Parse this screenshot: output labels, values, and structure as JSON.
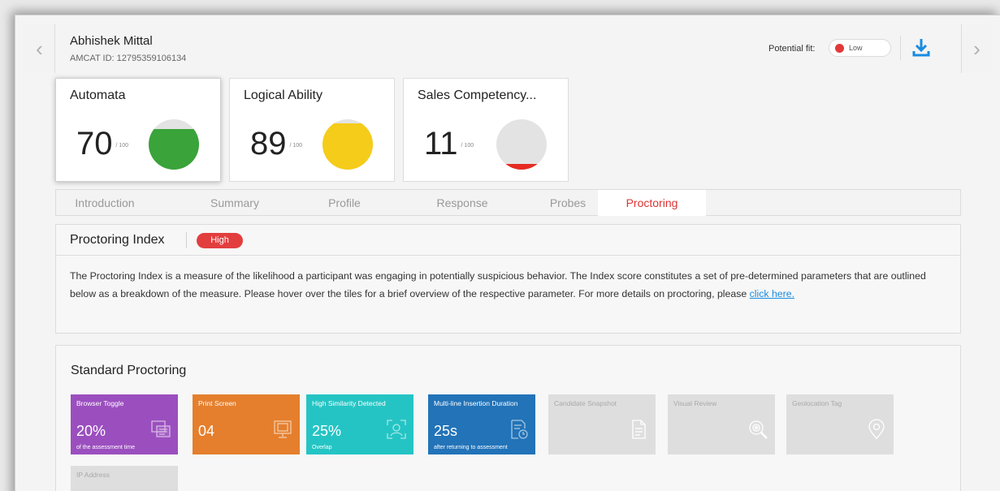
{
  "candidate": {
    "name": "Abhishek Mittal",
    "amcat_id": "AMCAT ID: 12795359106134"
  },
  "header": {
    "potential_fit_label": "Potential fit:",
    "potential_fit_value": "Low",
    "fit_color": "#e23a3a"
  },
  "scores": [
    {
      "title": "Automata",
      "value": "70",
      "max": "/ 100",
      "fill_level": 0.8,
      "color": "#3aa33a"
    },
    {
      "title": "Logical Ability",
      "value": "89",
      "max": "/ 100",
      "fill_level": 0.92,
      "color": "#f5cc1a"
    },
    {
      "title": "Sales Competency...",
      "value": "11",
      "max": "/ 100",
      "fill_level": 0.12,
      "color": "#e52b22"
    }
  ],
  "tabs": [
    {
      "label": "Introduction"
    },
    {
      "label": "Summary"
    },
    {
      "label": "Profile"
    },
    {
      "label": "Response"
    },
    {
      "label": "Probes"
    },
    {
      "label": "Proctoring"
    }
  ],
  "active_tab": "Proctoring",
  "proctoring_index": {
    "title": "Proctoring Index",
    "badge": "High",
    "description": "The Proctoring Index is a measure of the likelihood a participant was engaging in potentially suspicious behavior. The Index score constitutes a set of pre-determined parameters that are outlined below as a breakdown of the measure. Please hover over the tiles for a brief overview of the respective parameter. For more details on proctoring, please ",
    "link_text": "click here."
  },
  "standard_proctoring": {
    "title": "Standard Proctoring",
    "tiles": [
      {
        "name": "Browser Toggle",
        "value": "20%",
        "sub": "of the assessment time",
        "color": "#9b4fbf",
        "icon": "browser-windows-icon"
      },
      {
        "name": "Print Screen",
        "value": "04",
        "sub": "",
        "color": "#e57f2d",
        "icon": "monitor-icon"
      },
      {
        "name": "High Similarity Detected",
        "value": "25%",
        "sub": "Overlap",
        "color": "#25c4c4",
        "icon": "face-scan-icon"
      },
      {
        "name": "Multi-line Insertion Duration",
        "value": "25s",
        "sub": "after returning to assessment",
        "color": "#2273b8",
        "icon": "document-clock-icon"
      },
      {
        "name": "Candidate Snapshot",
        "value": "",
        "sub": "",
        "color": "#dedede",
        "icon": "document-icon"
      },
      {
        "name": "Visual Review",
        "value": "",
        "sub": "",
        "color": "#dedede",
        "icon": "eye-search-icon"
      },
      {
        "name": "Geolocation Tag",
        "value": "",
        "sub": "",
        "color": "#dedede",
        "icon": "location-pin-icon"
      },
      {
        "name": "IP Address",
        "value": "",
        "sub": "",
        "color": "#dedede",
        "icon": ""
      }
    ]
  }
}
